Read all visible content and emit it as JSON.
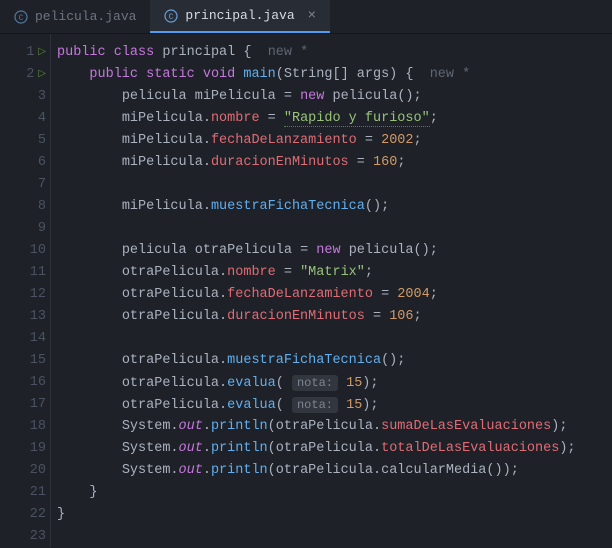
{
  "tabs": [
    {
      "label": "pelicula.java",
      "active": false,
      "icon_color": "#5f8dbb"
    },
    {
      "label": "principal.java",
      "active": true,
      "icon_color": "#5f8dbb"
    }
  ],
  "gutter": {
    "run_lines": [
      1,
      2
    ],
    "line_count": 23
  },
  "hints": {
    "new_class": "new *",
    "new_method": "new *",
    "nota": "nota:"
  },
  "code": {
    "l1": {
      "kw1": "public",
      "kw2": "class",
      "cls": "principal",
      "brace": "{"
    },
    "l2": {
      "kw1": "public",
      "kw2": "static",
      "kw3": "void",
      "fn": "main",
      "sig": "(String[] args) {"
    },
    "l3": {
      "ty": "pelicula",
      "id": "miPelicula",
      "eq": "=",
      "kw": "new",
      "ctor": "pelicula",
      "paren": "();"
    },
    "l4": {
      "id": "miPelicula",
      "dot": ".",
      "fld": "nombre",
      "eq": "=",
      "str": "\"Rapido y furioso\"",
      "semi": ";"
    },
    "l5": {
      "id": "miPelicula",
      "dot": ".",
      "fld": "fechaDeLanzamiento",
      "eq": "=",
      "num": "2002",
      "semi": ";"
    },
    "l6": {
      "id": "miPelicula",
      "dot": ".",
      "fld": "duracionEnMinutos",
      "eq": "=",
      "num": "160",
      "semi": ";"
    },
    "l8": {
      "id": "miPelicula",
      "dot": ".",
      "fn": "muestraFichaTecnica",
      "paren": "();"
    },
    "l10": {
      "ty": "pelicula",
      "id": "otraPelicula",
      "eq": "=",
      "kw": "new",
      "ctor": "pelicula",
      "paren": "();"
    },
    "l11": {
      "id": "otraPelicula",
      "dot": ".",
      "fld": "nombre",
      "eq": "=",
      "str": "\"Matrix\"",
      "semi": ";"
    },
    "l12": {
      "id": "otraPelicula",
      "dot": ".",
      "fld": "fechaDeLanzamiento",
      "eq": "=",
      "num": "2004",
      "semi": ";"
    },
    "l13": {
      "id": "otraPelicula",
      "dot": ".",
      "fld": "duracionEnMinutos",
      "eq": "=",
      "num": "106",
      "semi": ";"
    },
    "l15": {
      "id": "otraPelicula",
      "dot": ".",
      "fn": "muestraFichaTecnica",
      "paren": "();"
    },
    "l16": {
      "id": "otraPelicula",
      "dot": ".",
      "fn": "evalua",
      "open": "(",
      "num": "15",
      "close": ");"
    },
    "l17": {
      "id": "otraPelicula",
      "dot": ".",
      "fn": "evalua",
      "open": "(",
      "num": "15",
      "close": ");"
    },
    "l18": {
      "cls": "System",
      "dot1": ".",
      "out": "out",
      "dot2": ".",
      "fn": "println",
      "open": "(otraPelicula.",
      "fld": "sumaDeLasEvaluaciones",
      "close": ");"
    },
    "l19": {
      "cls": "System",
      "dot1": ".",
      "out": "out",
      "dot2": ".",
      "fn": "println",
      "open": "(otraPelicula.",
      "fld": "totalDeLasEvaluaciones",
      "close": ");"
    },
    "l20": {
      "cls": "System",
      "dot1": ".",
      "out": "out",
      "dot2": ".",
      "fn": "println",
      "open": "(otraPelicula.",
      "call": "calcularMedia",
      "close2": "());"
    },
    "l21": {
      "brace": "}"
    },
    "l22": {
      "brace": "}"
    }
  }
}
